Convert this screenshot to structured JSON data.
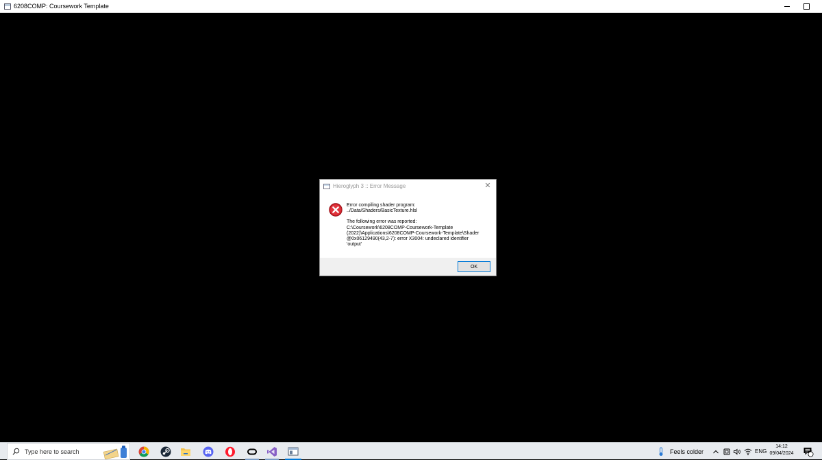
{
  "window": {
    "title": "6208COMP: Coursework Template"
  },
  "dialog": {
    "title": "Hieroglyph 3 :: Error Message",
    "close_glyph": "✕",
    "message_lines": [
      "Error compiling shader program:",
      "../Data/Shaders/BasicTexture.hlsl",
      "",
      "The following error was reported:",
      "C:\\Coursework\\6208COMP-Coursework-Template",
      "(2022)\\Applications\\6208COMP-Coursework-Template\\Shader",
      "@0x06129490(43,2-7): error X3004: undeclared identifier",
      "'output'"
    ],
    "ok_label": "OK"
  },
  "taskbar": {
    "search_placeholder": "Type here to search",
    "apps": [
      "file-explorer-widget",
      "chrome",
      "steam",
      "file-explorer",
      "discord",
      "opera",
      "oculus",
      "visual-studio",
      "coursework-app"
    ],
    "weather": "Feels colder",
    "language": "ENG",
    "time": "14:12",
    "date": "09/04/2024",
    "notification_count": "1"
  },
  "colors": {
    "accent": "#0078d7",
    "error_red": "#d9232d"
  }
}
